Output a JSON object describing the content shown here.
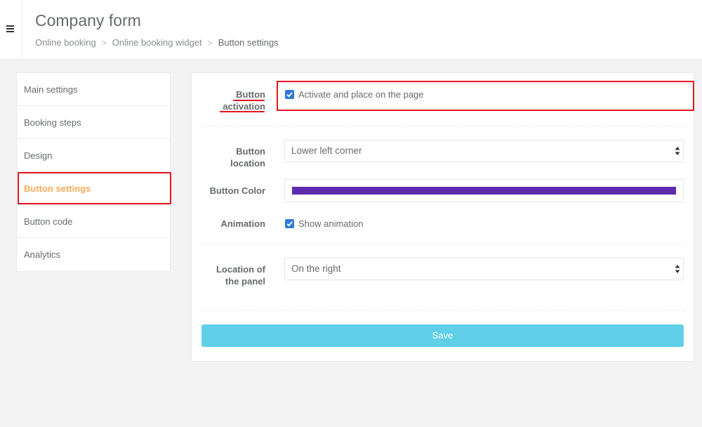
{
  "header": {
    "title": "Company form",
    "breadcrumb": [
      "Online booking",
      "Online booking widget",
      "Button settings"
    ],
    "separator": ">"
  },
  "sidebar": {
    "items": [
      {
        "label": "Main settings",
        "active": false
      },
      {
        "label": "Booking steps",
        "active": false
      },
      {
        "label": "Design",
        "active": false
      },
      {
        "label": "Button settings",
        "active": true
      },
      {
        "label": "Button code",
        "active": false
      },
      {
        "label": "Analytics",
        "active": false
      }
    ]
  },
  "form": {
    "activation": {
      "label_line1": "Button",
      "label_line2": "activation",
      "checkbox_label": "Activate and place on the page",
      "checked": true
    },
    "location": {
      "label_line1": "Button",
      "label_line2": "location",
      "value": "Lower left corner"
    },
    "color": {
      "label": "Button Color",
      "value": "#5e2bb0"
    },
    "animation": {
      "label": "Animation",
      "checkbox_label": "Show animation",
      "checked": true
    },
    "panel_location": {
      "label_line1": "Location of",
      "label_line2": "the panel",
      "value": "On the right"
    },
    "save_label": "Save"
  },
  "colors": {
    "accent_active": "#f8ac59",
    "save_button": "#60cfe7",
    "checkbox": "#2f7bd8",
    "annotation_red": "#e4161e"
  }
}
